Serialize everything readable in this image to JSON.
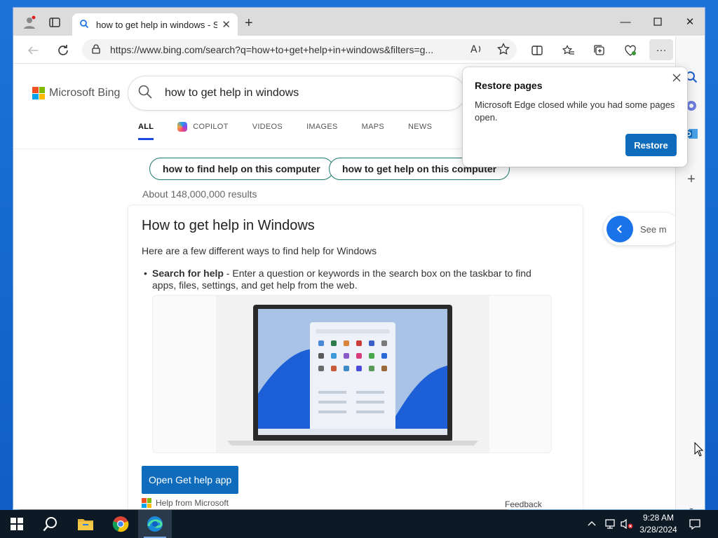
{
  "window": {
    "tab_title": "how to get help in windows - Search",
    "url": "https://www.bing.com/search?q=how+to+get+help+in+windows&filters=g..."
  },
  "bing": {
    "logo_text": "Microsoft Bing",
    "query": "how to get help in windows",
    "scopes": [
      "ALL",
      "COPILOT",
      "VIDEOS",
      "IMAGES",
      "MAPS",
      "NEWS"
    ],
    "chips": [
      "how to find help on this computer",
      "how to get help on this computer"
    ],
    "results_count": "About 148,000,000 results",
    "see_more": "See m"
  },
  "answer_card": {
    "title": "How to get help in Windows",
    "intro": "Here are a few different ways to find help for Windows",
    "bullet_bold": "Search for help",
    "bullet_text": " - Enter a question or keywords in the search box on the taskbar to find apps, files, settings, and get help from the web.",
    "button_label": "Open Get help app",
    "source": "Help from Microsoft",
    "feedback": "Feedback"
  },
  "restore_popup": {
    "title": "Restore pages",
    "message": "Microsoft Edge closed while you had some pages open.",
    "button_label": "Restore"
  },
  "taskbar": {
    "time": "9:28 AM",
    "date": "3/28/2024"
  },
  "colors": {
    "accent": "#0f6cbd",
    "scope_underline": "#174ae4",
    "chip_border": "#1c7a6a",
    "taskbar": "#0d1a26"
  }
}
